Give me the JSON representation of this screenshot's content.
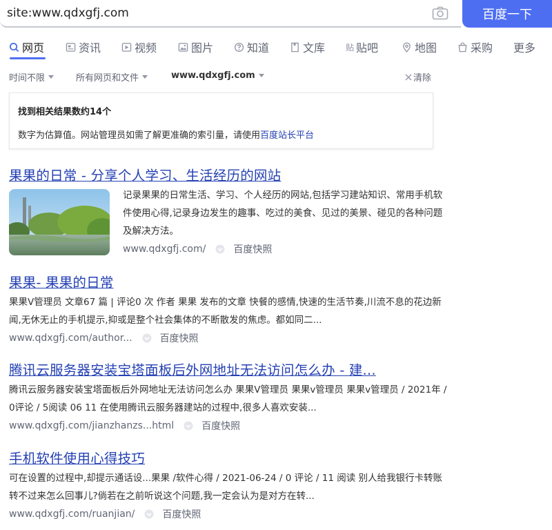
{
  "search": {
    "query": "site:www.qdxgfj.com",
    "button_label": "百度一下"
  },
  "tabs": [
    {
      "label": "网页",
      "icon": "search-icon",
      "active": true
    },
    {
      "label": "资讯",
      "icon": "news-icon"
    },
    {
      "label": "视频",
      "icon": "video-icon"
    },
    {
      "label": "图片",
      "icon": "image-icon"
    },
    {
      "label": "知道",
      "icon": "question-icon"
    },
    {
      "label": "文库",
      "icon": "document-icon"
    },
    {
      "label": "贴吧",
      "icon": "tieba-icon"
    },
    {
      "label": "地图",
      "icon": "map-pin-icon"
    },
    {
      "label": "采购",
      "icon": "shopping-bag-icon"
    },
    {
      "label": "更多"
    }
  ],
  "filters": {
    "time": "时间不限",
    "type": "所有网页和文件",
    "site": "www.qdxgfj.com",
    "clear": "清除"
  },
  "info": {
    "title": "找到相关结果数约14个",
    "line_prefix": "数字为估算值。网站管理员如需了解更准确的索引量，请使用",
    "link": "百度站长平台"
  },
  "results": [
    {
      "title": "果果的日常 - 分享个人学习、生活经历的网站",
      "abstract": "记录果果的日常生活、学习、个人经历的网站,包括学习建站知识、常用手机软件使用心得,记录身边发生的趣事、吃过的美食、见过的美景、碰见的各种问题及解决方法。",
      "url": "www.qdxgfj.com/",
      "kuaizhao": "百度快照"
    },
    {
      "title": "果果- 果果的日常",
      "abstract": "果果V管理员 文章67 篇 | 评论0 次 作者 果果 发布的文章 快餐的感情,快速的生活节奏,川流不息的花边新闻,无休无止的手机提示,抑或是整个社会集体的不断散发的焦虑。都如同二...",
      "url": "www.qdxgfj.com/author...",
      "kuaizhao": "百度快照"
    },
    {
      "title": "腾讯云服务器安装宝塔面板后外网地址无法访问怎么办 - 建...",
      "abstract": "腾讯云服务器安装宝塔面板后外网地址无法访问怎么办 果果V管理员 果果v管理员 果果v管理员 / 2021年 / 0评论 / 5阅读 06 11 在使用腾讯云服务器建站的过程中,很多人喜欢安装...",
      "url": "www.qdxgfj.com/jianzhanzs...html",
      "kuaizhao": "百度快照"
    },
    {
      "title": "手机软件使用心得技巧",
      "abstract": "可在设置的过程中,却提示通话设...果果 /软件心得 / 2021-06-24 / 0 评论 / 11 阅读 别人给我银行卡转账转不过来怎么回事儿?倘若在之前听说这个问题,我一定会认为是对方在转...",
      "url": "www.qdxgfj.com/ruanjian/",
      "kuaizhao": "百度快照"
    }
  ],
  "colors": {
    "accent": "#4e6ef2",
    "link": "#2440b3",
    "muted": "#626675"
  }
}
